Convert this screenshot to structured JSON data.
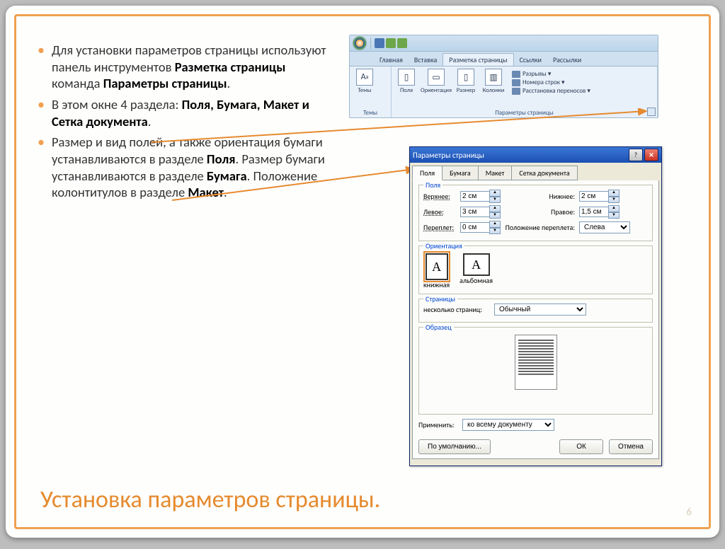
{
  "bullets": {
    "b1_prefix": "Для установки параметров страницы используют панель инструментов ",
    "b1_bold1": "Разметка страницы",
    "b1_mid": " команда ",
    "b1_bold2": "Параметры страницы",
    "b1_suffix": ".",
    "b2_prefix": "В этом окне 4 раздела: ",
    "b2_bold": "Поля, Бумага, Макет и Сетка документа",
    "b2_suffix": ".",
    "b3_prefix": "Размер и вид полей, а также ориентация бумаги устанавливаются в разделе ",
    "b3_bold1": "Поля",
    "b3_mid1": ". Размер бумаги устанавливаются в разделе ",
    "b3_bold2": "Бумага",
    "b3_mid2": ". Положение колонтитулов в разделе ",
    "b3_bold3": "Макет",
    "b3_suffix": "."
  },
  "title": "Установка параметров страницы.",
  "page_num": "6",
  "ribbon": {
    "tabs": [
      "Главная",
      "Вставка",
      "Разметка страницы",
      "Ссылки",
      "Рассылки"
    ],
    "active_tab": 2,
    "group_themes": "Темы",
    "group_page": "Параметры страницы",
    "btn_themes": "Темы",
    "btn_margins": "Поля",
    "btn_orient": "Ориентация",
    "btn_size": "Размер",
    "btn_columns": "Колонки",
    "line_breaks": "Разрывы ▾",
    "line_numbers": "Номера строк ▾",
    "line_hyphen": "Расстановка переносов ▾"
  },
  "dialog": {
    "title": "Параметры страницы",
    "tabs": [
      "Поля",
      "Бумага",
      "Макет",
      "Сетка документа"
    ],
    "sec_fields": "Поля",
    "lbl_top": "Верхнее:",
    "val_top": "2 см",
    "lbl_bottom": "Нижнее:",
    "val_bottom": "2 см",
    "lbl_left": "Левое:",
    "val_left": "3 см",
    "lbl_right": "Правое:",
    "val_right": "1,5 см",
    "lbl_gutter": "Переплет:",
    "val_gutter": "0 см",
    "lbl_gutter_pos": "Положение переплета:",
    "val_gutter_pos": "Слева",
    "sec_orient": "Ориентация",
    "orient_portrait": "книжная",
    "orient_landscape": "альбомная",
    "sec_pages": "Страницы",
    "lbl_multi": "несколько страниц:",
    "val_multi": "Обычный",
    "sec_preview": "Образец",
    "lbl_apply": "Применить:",
    "val_apply": "ко всему документу",
    "btn_default": "По умолчанию...",
    "btn_ok": "ОК",
    "btn_cancel": "Отмена"
  }
}
